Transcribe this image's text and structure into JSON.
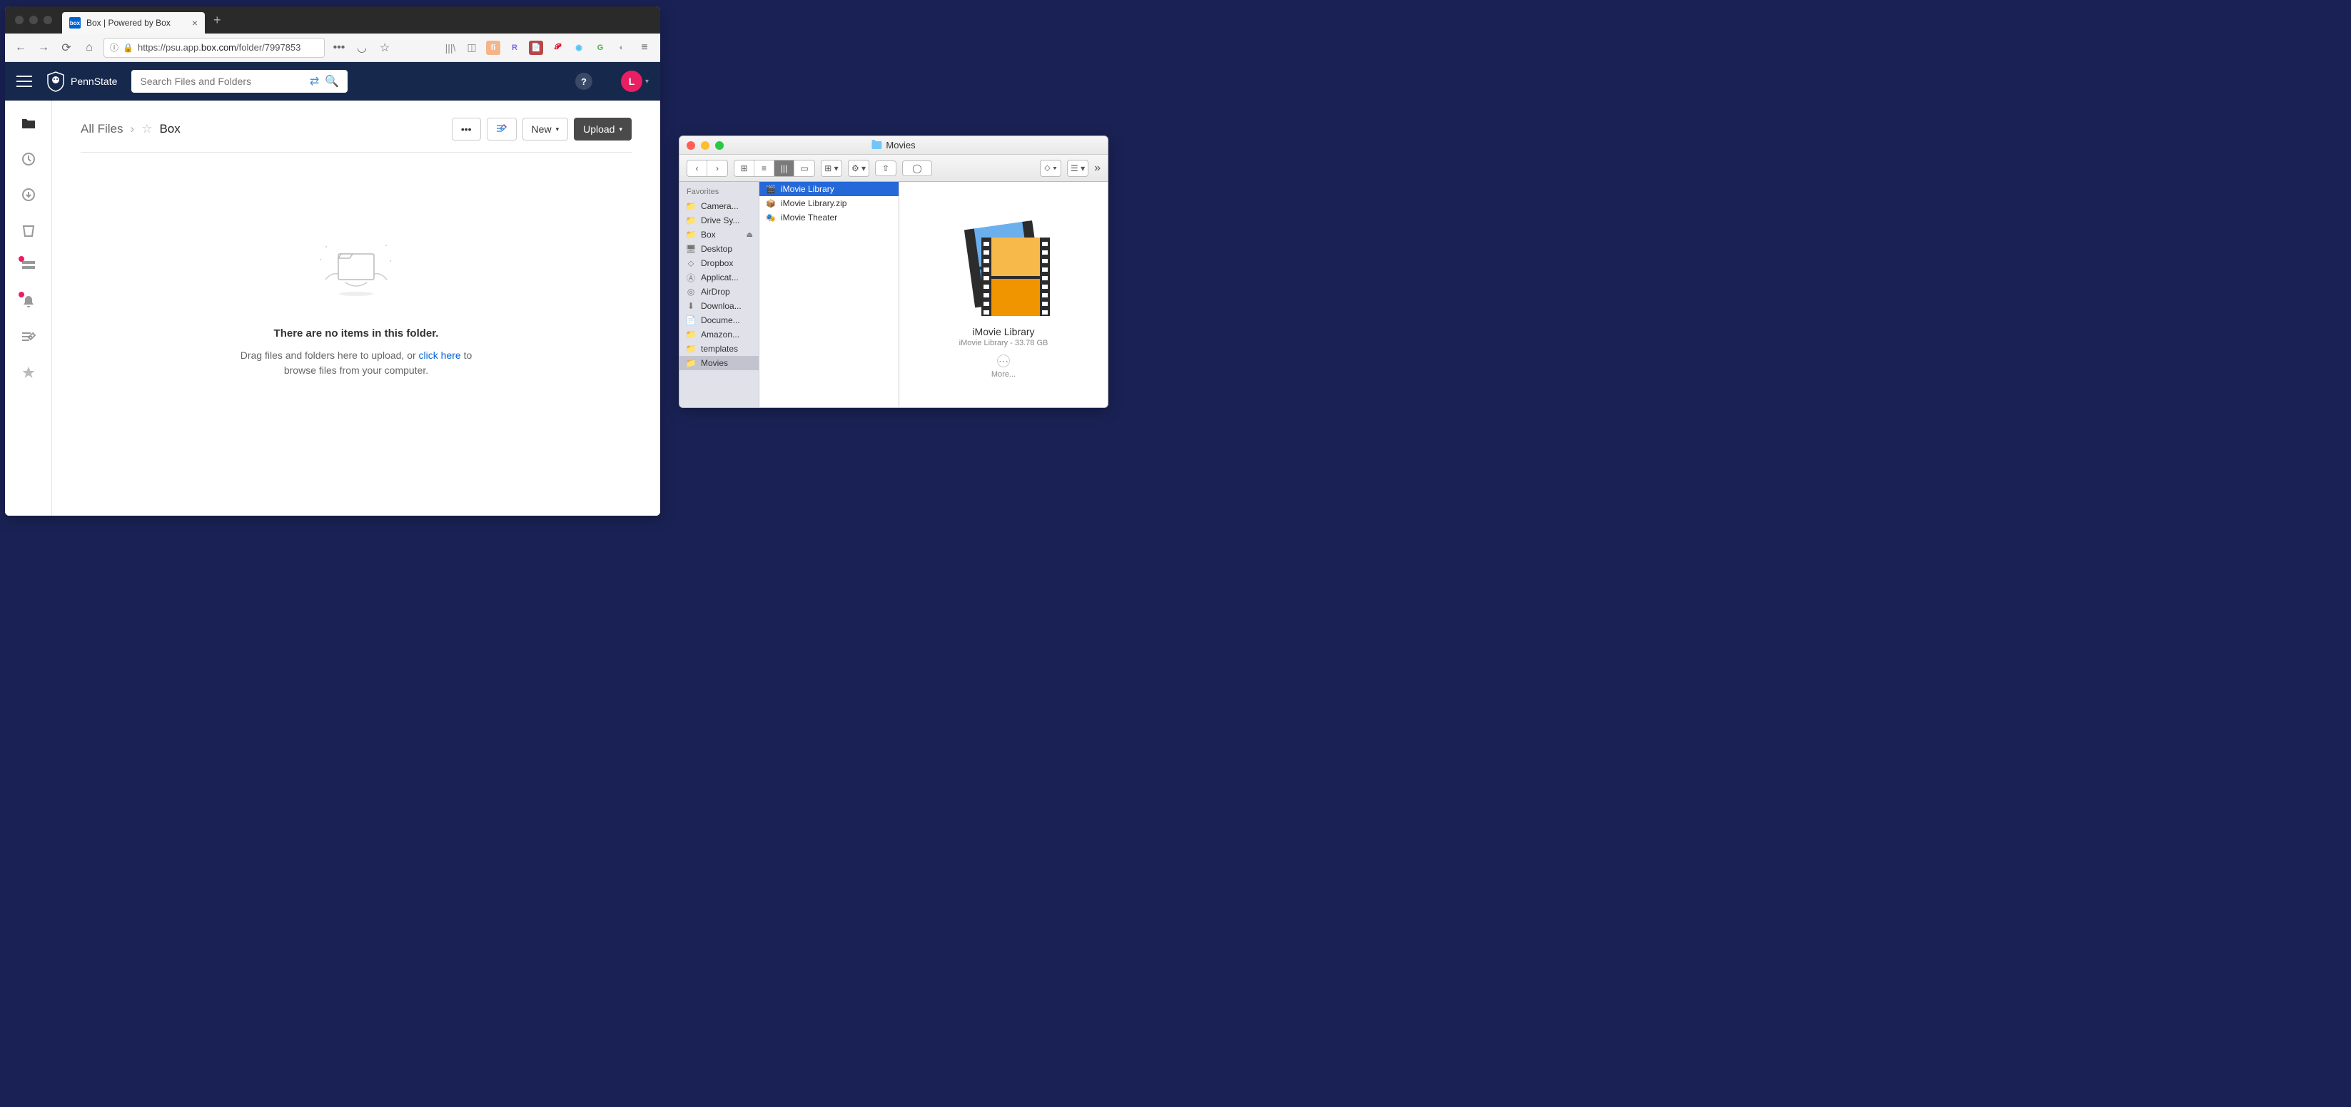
{
  "browser": {
    "tab_title": "Box | Powered by Box",
    "url_prefix": "https://",
    "url_host_pre": "psu.app.",
    "url_domain": "box.com",
    "url_path": "/folder/7997853"
  },
  "box": {
    "brand": "PennState",
    "search_placeholder": "Search Files and Folders",
    "user_initial": "L",
    "breadcrumb_root": "All Files",
    "breadcrumb_current": "Box",
    "btn_new": "New",
    "btn_upload": "Upload",
    "empty_title": "There are no items in this folder.",
    "empty_text_pre": "Drag files and folders here to upload, or ",
    "empty_link": "click here",
    "empty_text_post": " to browse files from your computer."
  },
  "finder": {
    "title": "Movies",
    "sidebar_header": "Favorites",
    "sidebar": [
      {
        "label": "Camera...",
        "icon": "folder"
      },
      {
        "label": "Drive Sy...",
        "icon": "folder"
      },
      {
        "label": "Box",
        "icon": "folder",
        "eject": true
      },
      {
        "label": "Desktop",
        "icon": "desktop"
      },
      {
        "label": "Dropbox",
        "icon": "dropbox"
      },
      {
        "label": "Applicat...",
        "icon": "apps"
      },
      {
        "label": "AirDrop",
        "icon": "airdrop"
      },
      {
        "label": "Downloa...",
        "icon": "downloads"
      },
      {
        "label": "Docume...",
        "icon": "documents"
      },
      {
        "label": "Amazon...",
        "icon": "folder"
      },
      {
        "label": "templates",
        "icon": "folder"
      },
      {
        "label": "Movies",
        "icon": "folder",
        "selected": true
      }
    ],
    "files": [
      {
        "name": "iMovie Library",
        "selected": true,
        "icon": "imovie"
      },
      {
        "name": "iMovie Library.zip",
        "icon": "zip"
      },
      {
        "name": "iMovie Theater",
        "icon": "theater"
      }
    ],
    "preview_title": "iMovie Library",
    "preview_sub": "iMovie Library - 33.78 GB",
    "preview_more": "More..."
  }
}
